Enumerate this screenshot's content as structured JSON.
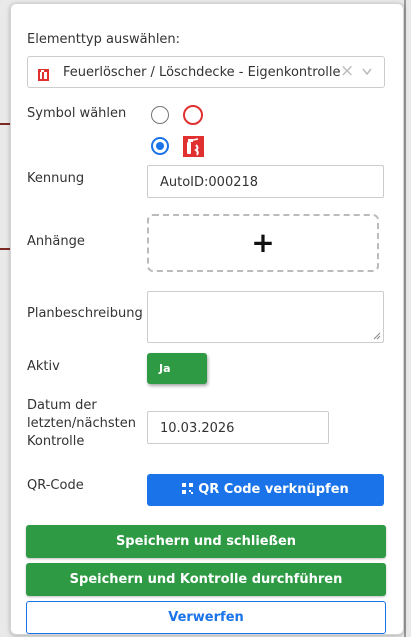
{
  "form": {
    "element_type": {
      "label": "Elementtyp auswählen:",
      "selected": "Feuerlöscher / Löschdecke - Eigenkontrolle",
      "clear_icon": "close-icon",
      "chevron_icon": "chevron-down-icon"
    },
    "symbol": {
      "label": "Symbol wählen",
      "options": [
        {
          "icon": "red-circle-icon",
          "checked": false
        },
        {
          "icon": "fire-extinguisher-icon",
          "checked": true
        }
      ]
    },
    "kennung": {
      "label": "Kennung",
      "value": "AutoID:000218"
    },
    "anhaenge": {
      "label": "Anhänge",
      "add_symbol": "+"
    },
    "planbeschreibung": {
      "label": "Planbeschreibung",
      "value": ""
    },
    "aktiv": {
      "label": "Aktiv",
      "toggle_label": "Ja",
      "on": true
    },
    "datum": {
      "label_line1": "Datum der",
      "label_line2": "letzten/nächsten",
      "label_line3": "Kontrolle",
      "value": "10.03.2026"
    },
    "qr": {
      "label": "QR-Code",
      "button_label": "QR Code verknüpfen",
      "button_icon": "qr-code-icon"
    }
  },
  "actions": {
    "save_close": "Speichern und schließen",
    "save_control": "Speichern und Kontrolle durchführen",
    "discard": "Verwerfen"
  },
  "colors": {
    "primary_blue": "#1a73e8",
    "success_green": "#2e9a44",
    "fire_red": "#e03030"
  }
}
